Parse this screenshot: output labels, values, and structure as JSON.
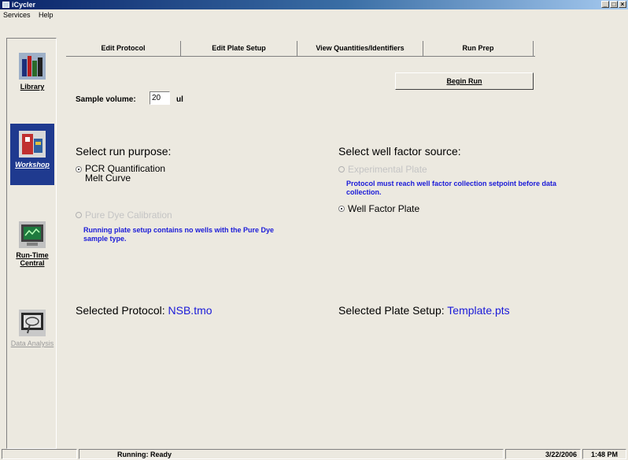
{
  "window": {
    "title": "iCycler",
    "min_icon": "minimize-icon",
    "restore_icon": "restore-icon",
    "close_icon": "close-icon"
  },
  "menu": {
    "items": [
      "Services",
      "Help"
    ]
  },
  "sidebar": {
    "items": [
      {
        "label": "Library",
        "icon": "library-books-icon"
      },
      {
        "label": "Workshop",
        "icon": "workshop-icon"
      },
      {
        "label": "Run-Time Central",
        "icon": "run-time-monitor-icon"
      },
      {
        "label": "Data Analysis",
        "icon": "data-analysis-icon"
      }
    ]
  },
  "tabs": [
    "Edit Protocol",
    "Edit Plate Setup",
    "View Quantities/Identifiers",
    "Run Prep"
  ],
  "run_prep": {
    "sample_volume_label": "Sample volume:",
    "sample_volume_value": "20",
    "sample_volume_unit": "ul",
    "begin_run_label": "Begin Run",
    "run_purpose_heading": "Select run purpose:",
    "run_purpose_options": [
      "PCR Quantification",
      "Melt Curve"
    ],
    "pure_dye_option": "Pure Dye Calibration",
    "pure_dye_note": "Running plate setup contains no wells with the Pure Dye sample type.",
    "well_factor_heading": "Select well factor source:",
    "experimental_plate_option": "Experimental Plate",
    "experimental_plate_note": "Protocol must reach well factor collection setpoint before data collection.",
    "well_factor_plate_option": "Well Factor Plate",
    "selected_protocol_label": "Selected Protocol:",
    "selected_protocol_value": "NSB.tmo",
    "selected_plate_label": "Selected Plate Setup:",
    "selected_plate_value": "Template.pts"
  },
  "status": {
    "left": "",
    "message": "Running: Ready",
    "date": "3/22/2006",
    "time": "1:48 PM"
  },
  "colors": {
    "accent_blue": "#1a1ad8",
    "active_nav": "#1f3a8f",
    "background": "#ece9e0"
  }
}
